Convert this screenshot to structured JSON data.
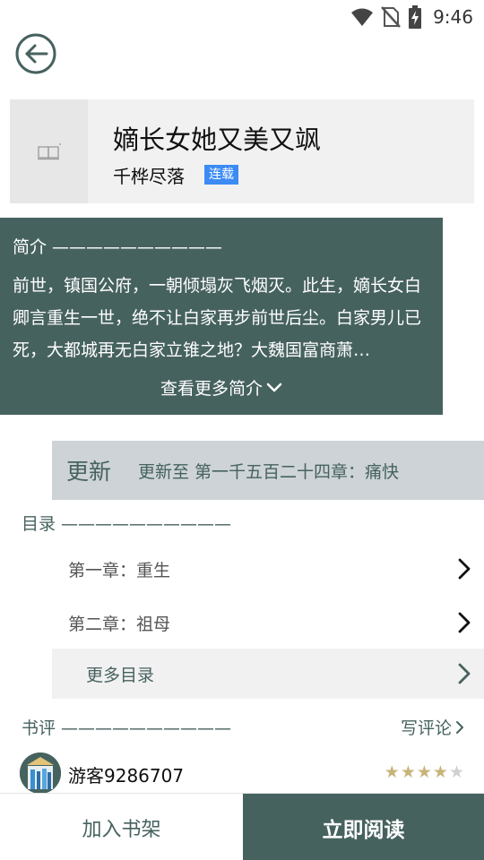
{
  "status_bar": {
    "time": "9:46"
  },
  "book": {
    "title": "嫡长女她又美又飒",
    "author": "千桦尽落",
    "status_tag": "连载"
  },
  "intro": {
    "header": "简介 ——————————",
    "text": "前世，镇国公府，一朝倾塌灰飞烟灭。此生，嫡长女白卿言重生一世，绝不让白家再步前世后尘。白家男儿已死，大都城再无白家立锥之地？大魏国富商萧…",
    "more_label": "查看更多简介"
  },
  "update": {
    "label": "更新",
    "text": "更新至 第一千五百二十四章：痛快"
  },
  "toc": {
    "header": "目录 ——————————",
    "chapters": [
      "第一章：重生",
      "第二章：祖母"
    ],
    "more_label": "更多目录"
  },
  "reviews": {
    "header": "书评 ——————————",
    "write_label": "写评论",
    "items": [
      {
        "username": "游客9286707",
        "rating": 4,
        "max_rating": 5
      }
    ]
  },
  "actions": {
    "add_shelf": "加入书架",
    "read_now": "立即阅读"
  },
  "colors": {
    "accent": "#46625f",
    "tag_blue": "#3c8bf5",
    "star_filled": "#c8b47a",
    "star_empty": "#d0d0d0"
  }
}
